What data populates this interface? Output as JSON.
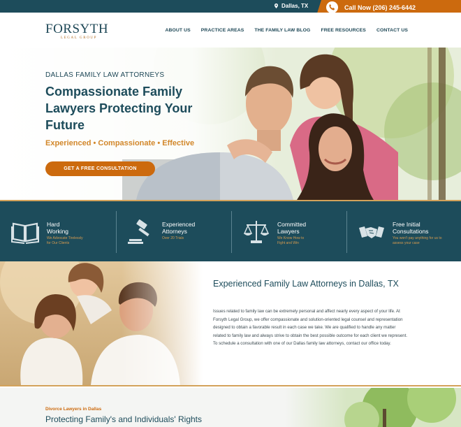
{
  "topbar": {
    "location": "Dallas, TX",
    "call": "Call Now (206) 245-6442"
  },
  "logo": {
    "name": "FORSYTH",
    "sub": "LEGAL GROUP"
  },
  "nav": [
    "ABOUT US",
    "PRACTICE AREAS",
    "THE FAMILY LAW BLOG",
    "FREE RESOURCES",
    "CONTACT US"
  ],
  "hero": {
    "kicker": "DALLAS FAMILY LAW ATTORNEYS",
    "title": "Compassionate Family Lawyers Protecting Your Future",
    "tagline": "Experienced • Compassionate • Effective",
    "cta": "GET A FREE CONSULTATION"
  },
  "features": [
    {
      "title": "Hard\nWorking",
      "desc": "We Advocate Tirelessly\nfor Our Clients",
      "icon": "book-icon"
    },
    {
      "title": "Experienced\nAttorneys",
      "desc": "Over 20 Trials",
      "icon": "gavel-icon"
    },
    {
      "title": "Committed\nLawyers",
      "desc": "We Know How to\nFight and Win",
      "icon": "scales-icon"
    },
    {
      "title": "Free Initial\nConsultations",
      "desc": "You won't pay anything for us to\nassess your case",
      "icon": "handshake-icon"
    }
  ],
  "about": {
    "heading": "Experienced Family Law Attorneys in Dallas, TX",
    "body": "Issues related to family law can be extremely personal and affect nearly every aspect of your life. At Forsyth Legal Group, we offer compassionate and solution-oriented legal counsel and representation designed to obtain a favorable result in each case we take. We are qualified to handle any matter related to family law and always strive to obtain the best possible outcome for each client we represent. To schedule a consultation with one of our Dallas family law attorneys, contact our office today."
  },
  "bottom": {
    "kicker": "Divorce Lawyers in Dallas",
    "heading": "Protecting Family's and Individuals' Rights"
  },
  "colors": {
    "navy": "#1d4c5b",
    "orange": "#cc6a0e",
    "gold": "#d69b4f"
  }
}
